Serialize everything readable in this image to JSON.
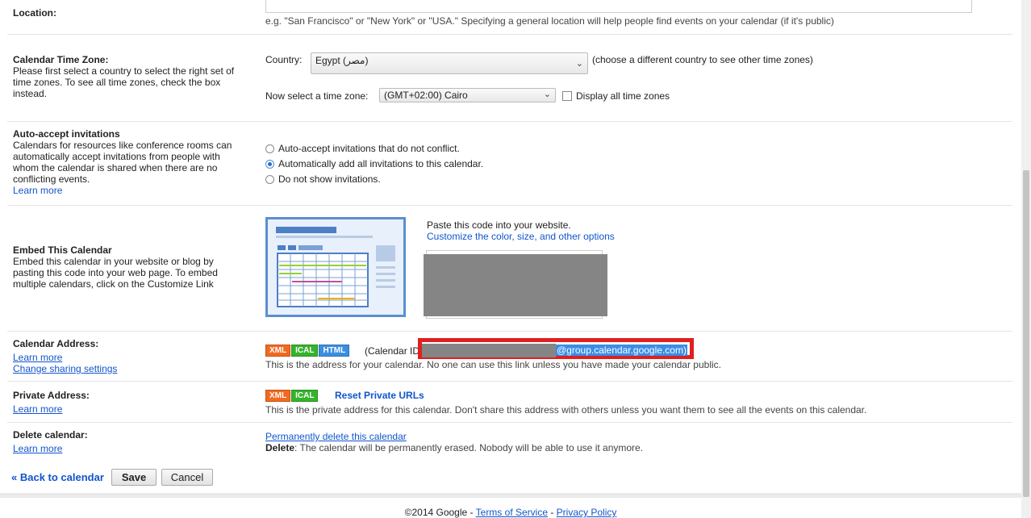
{
  "location": {
    "label": "Location:",
    "hint": "e.g. \"San Francisco\" or \"New York\" or \"USA.\" Specifying a general location will help people find events on your calendar (if it's public)"
  },
  "timezone": {
    "title": "Calendar Time Zone:",
    "desc": "Please first select a country to select the right set of time zones. To see all time zones, check the box instead.",
    "country_label": "Country:",
    "country_value": "Egypt (مصر)",
    "country_hint": "(choose a different country to see other time zones)",
    "tz_label": "Now select a time zone:",
    "tz_value": "(GMT+02:00) Cairo",
    "display_all": "Display all time zones"
  },
  "auto_accept": {
    "title": "Auto-accept invitations",
    "desc": "Calendars for resources like conference rooms can automatically accept invitations from people with whom the calendar is shared when there are no conflicting events.",
    "learn_more": "Learn more",
    "options": [
      "Auto-accept invitations that do not conflict.",
      "Automatically add all invitations to this calendar.",
      "Do not show invitations."
    ]
  },
  "embed": {
    "title": "Embed This Calendar",
    "desc": "Embed this calendar in your website or blog by pasting this code into your web page. To embed multiple calendars, click on the Customize Link",
    "paste_text": "Paste this code into your website.",
    "customize_link": "Customize the color, size, and other options"
  },
  "address": {
    "title": "Calendar Address:",
    "learn_more": "Learn more",
    "change_sharing": "Change sharing settings",
    "tags": [
      "XML",
      "ICAL",
      "HTML"
    ],
    "calendar_id_prefix": "(Calendar ID",
    "calendar_id_domain": "@group.calendar.google.com)",
    "note": "This is the address for your calendar. No one can use this link unless you have made your calendar public."
  },
  "private": {
    "title": "Private Address:",
    "learn_more": "Learn more",
    "tags": [
      "XML",
      "ICAL"
    ],
    "reset_link": "Reset Private URLs",
    "note": "This is the private address for this calendar. Don't share this address with others unless you want them to see all the events on this calendar."
  },
  "delete": {
    "title": "Delete calendar:",
    "learn_more": "Learn more",
    "link": "Permanently delete this calendar",
    "bold": "Delete",
    "note": ": The calendar will be permanently erased. Nobody will be able to use it anymore."
  },
  "actions": {
    "back": "« Back to calendar",
    "save": "Save",
    "cancel": "Cancel"
  },
  "footer": {
    "copyright": "©2014 Google - ",
    "terms": "Terms of Service",
    "sep": " - ",
    "privacy": "Privacy Policy"
  },
  "colors": {
    "xml": "#f26a21",
    "ical": "#35b32c",
    "html": "#3b8ee0",
    "highlight_border": "#e01f1f",
    "link": "#1155cc"
  }
}
